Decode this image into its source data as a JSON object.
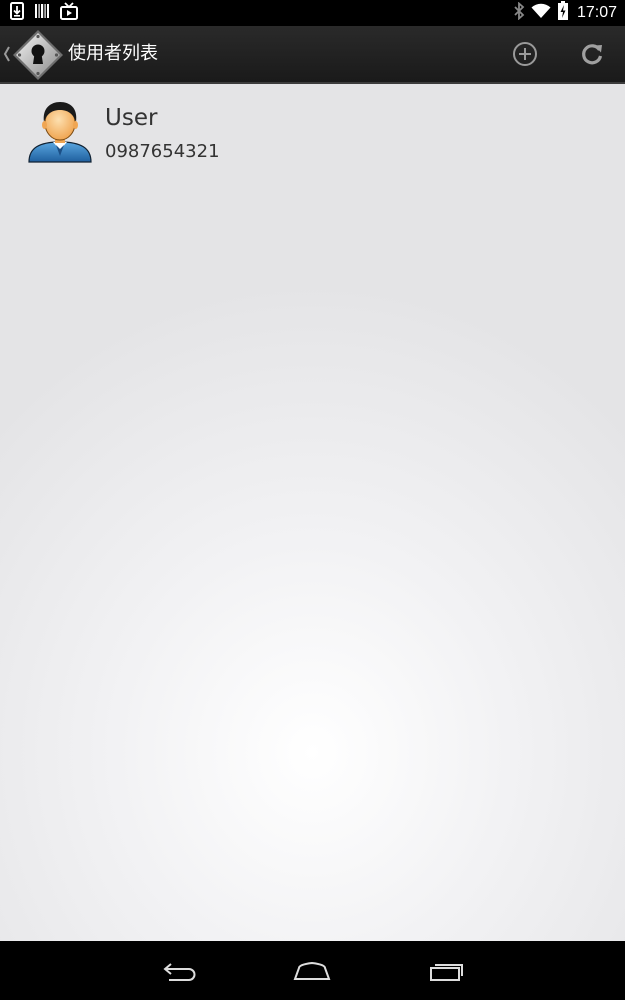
{
  "status_bar": {
    "time": "17:07",
    "icons": [
      "download-icon",
      "barcode-icon",
      "media-icon",
      "bluetooth-icon",
      "wifi-icon",
      "battery-icon"
    ]
  },
  "action_bar": {
    "title": "使用者列表",
    "actions": [
      "add-icon",
      "refresh-icon"
    ],
    "logo": "keyhole-lock-icon"
  },
  "users": [
    {
      "name": "User",
      "phone": "0987654321",
      "avatar": "user-avatar-icon"
    }
  ],
  "nav_bar": {
    "buttons": [
      "back-icon",
      "home-icon",
      "recents-icon"
    ]
  },
  "colors": {
    "action_bar": "#1e1e1e",
    "content_bg": "#ebebed",
    "text": "#333333"
  }
}
